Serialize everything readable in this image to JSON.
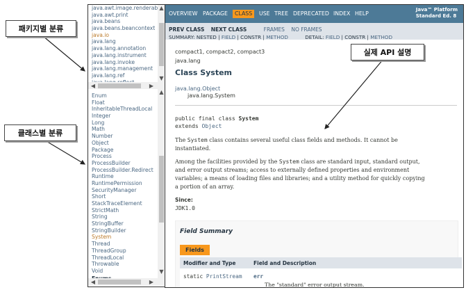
{
  "packages": [
    "java.awt.image.renderable",
    "java.awt.print",
    "java.beans",
    "java.beans.beancontext",
    "java.io",
    "java.lang",
    "java.lang.annotation",
    "java.lang.instrument",
    "java.lang.invoke",
    "java.lang.management",
    "java.lang.ref",
    "java.lang.reflect"
  ],
  "classes": [
    "Enum",
    "Float",
    "InheritableThreadLocal",
    "Integer",
    "Long",
    "Math",
    "Number",
    "Object",
    "Package",
    "Process",
    "ProcessBuilder",
    "ProcessBuilder.Redirect",
    "Runtime",
    "RuntimePermission",
    "SecurityManager",
    "Short",
    "StackTraceElement",
    "StrictMath",
    "String",
    "StringBuffer",
    "StringBuilder",
    "System",
    "Thread",
    "ThreadGroup",
    "ThreadLocal",
    "Throwable",
    "Void"
  ],
  "class_section_heading": "Enums",
  "nav": {
    "items": [
      "OVERVIEW",
      "PACKAGE",
      "CLASS",
      "USE",
      "TREE",
      "DEPRECATED",
      "INDEX",
      "HELP"
    ],
    "platform_line1": "Java™ Platform",
    "platform_line2": "Standard Ed. 8"
  },
  "subnav": {
    "prev": "PREV CLASS",
    "next": "NEXT CLASS",
    "frames": "FRAMES",
    "noframes": "NO FRAMES",
    "summary_prefix": "SUMMARY:",
    "summary_nested": "NESTED",
    "summary_field": "FIELD",
    "summary_constr": "CONSTR",
    "summary_method": "METHOD",
    "detail_prefix": "DETAIL:",
    "detail_field": "FIELD",
    "detail_constr": "CONSTR",
    "detail_method": "METHOD",
    "sep": "|"
  },
  "content": {
    "profiles": "compact1, compact2, compact3",
    "package": "java.lang",
    "title": "Class System",
    "parent": "java.lang.Object",
    "self": "java.lang.System",
    "decl_prefix": "public final class",
    "decl_name": "System",
    "extends_kw": "extends",
    "extends_name": "Object",
    "desc1_a": "The",
    "desc1_code": "System",
    "desc1_b": "class contains several useful class fields and methods. It cannot be",
    "desc1_c": "instantiated.",
    "desc2_l1a": "Among the facilities provided by the",
    "desc2_code": "System",
    "desc2_l1b": "class are standard input, standard output,",
    "desc2_l2": "and error output streams; access to externally defined properties and environment",
    "desc2_l3": "variables; a means of loading files and libraries; and a utility method for quickly copying",
    "desc2_l4": "a portion of an array.",
    "since_label": "Since:",
    "since_value": "JDK1.0",
    "field_summary": "Field Summary",
    "fields_tab": "Fields",
    "col1": "Modifier and Type",
    "col2": "Field and Description",
    "row1_mod": "static",
    "row1_type": "PrintStream",
    "row1_name": "err",
    "row1_desc": "The \"standard\" error output stream."
  },
  "callouts": {
    "package": "패키지별 분류",
    "class": "클래스별 분류",
    "api": "실제 API 설명"
  }
}
